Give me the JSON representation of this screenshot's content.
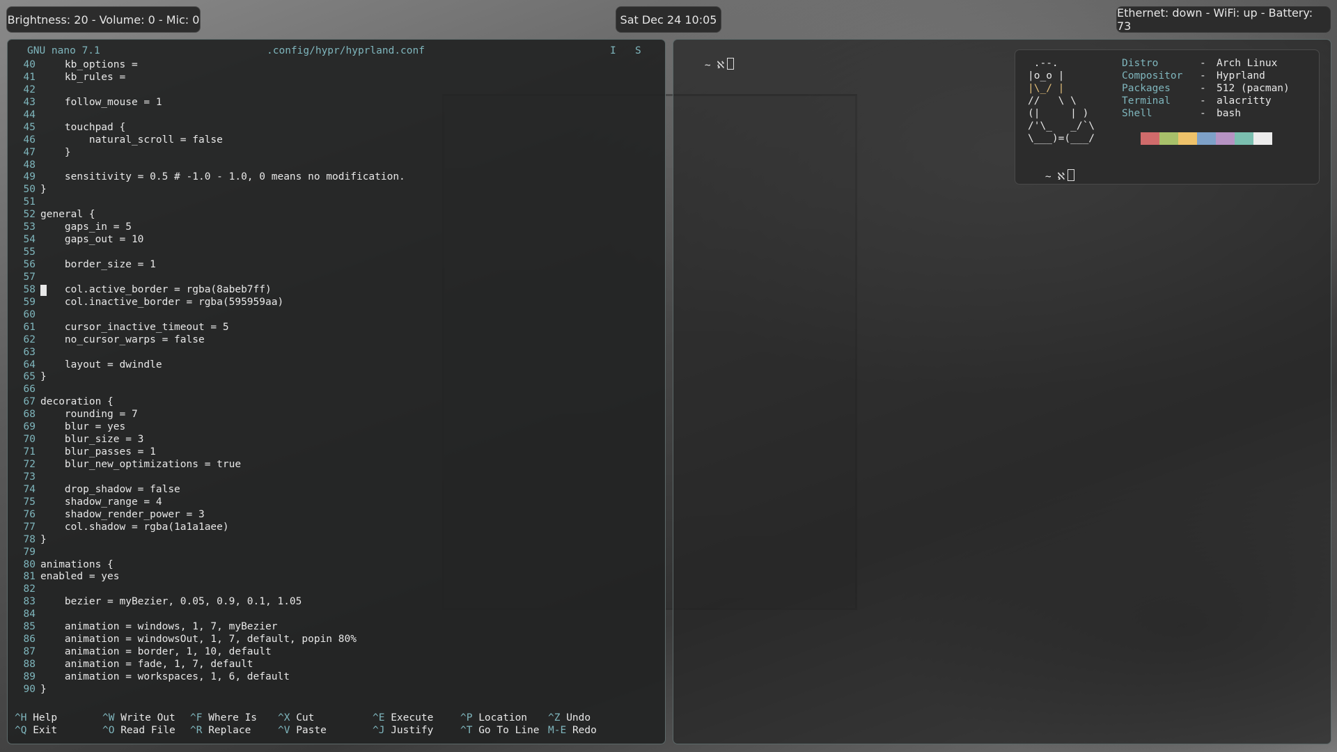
{
  "topbar": {
    "left": "Brightness: 20 - Volume: 0 - Mic: 0",
    "center": "Sat Dec 24 10:05",
    "right": "Ethernet: down - WiFi: up - Battery: 73"
  },
  "nano": {
    "version": "GNU nano 7.1",
    "filename": ".config/hypr/hyprland.conf",
    "flag_i": "I",
    "flag_s": "S",
    "cursor_line": "58",
    "lines": [
      {
        "n": "40",
        "t": "    kb_options ="
      },
      {
        "n": "41",
        "t": "    kb_rules ="
      },
      {
        "n": "42",
        "t": ""
      },
      {
        "n": "43",
        "t": "    follow_mouse = 1"
      },
      {
        "n": "44",
        "t": ""
      },
      {
        "n": "45",
        "t": "    touchpad {"
      },
      {
        "n": "46",
        "t": "        natural_scroll = false"
      },
      {
        "n": "47",
        "t": "    }"
      },
      {
        "n": "48",
        "t": ""
      },
      {
        "n": "49",
        "t": "    sensitivity = 0.5 # -1.0 - 1.0, 0 means no modification."
      },
      {
        "n": "50",
        "t": "}"
      },
      {
        "n": "51",
        "t": ""
      },
      {
        "n": "52",
        "t": "general {"
      },
      {
        "n": "53",
        "t": "    gaps_in = 5"
      },
      {
        "n": "54",
        "t": "    gaps_out = 10"
      },
      {
        "n": "55",
        "t": ""
      },
      {
        "n": "56",
        "t": "    border_size = 1"
      },
      {
        "n": "57",
        "t": ""
      },
      {
        "n": "58",
        "t": "    col.active_border = rgba(8abeb7ff)"
      },
      {
        "n": "59",
        "t": "    col.inactive_border = rgba(595959aa)"
      },
      {
        "n": "60",
        "t": ""
      },
      {
        "n": "61",
        "t": "    cursor_inactive_timeout = 5"
      },
      {
        "n": "62",
        "t": "    no_cursor_warps = false"
      },
      {
        "n": "63",
        "t": ""
      },
      {
        "n": "64",
        "t": "    layout = dwindle"
      },
      {
        "n": "65",
        "t": "}"
      },
      {
        "n": "66",
        "t": ""
      },
      {
        "n": "67",
        "t": "decoration {"
      },
      {
        "n": "68",
        "t": "    rounding = 7"
      },
      {
        "n": "69",
        "t": "    blur = yes"
      },
      {
        "n": "70",
        "t": "    blur_size = 3"
      },
      {
        "n": "71",
        "t": "    blur_passes = 1"
      },
      {
        "n": "72",
        "t": "    blur_new_optimizations = true"
      },
      {
        "n": "73",
        "t": ""
      },
      {
        "n": "74",
        "t": "    drop_shadow = false"
      },
      {
        "n": "75",
        "t": "    shadow_range = 4"
      },
      {
        "n": "76",
        "t": "    shadow_render_power = 3"
      },
      {
        "n": "77",
        "t": "    col.shadow = rgba(1a1a1aee)"
      },
      {
        "n": "78",
        "t": "}"
      },
      {
        "n": "79",
        "t": ""
      },
      {
        "n": "80",
        "t": "animations {"
      },
      {
        "n": "81",
        "t": "enabled = yes"
      },
      {
        "n": "82",
        "t": ""
      },
      {
        "n": "83",
        "t": "    bezier = myBezier, 0.05, 0.9, 0.1, 1.05"
      },
      {
        "n": "84",
        "t": ""
      },
      {
        "n": "85",
        "t": "    animation = windows, 1, 7, myBezier"
      },
      {
        "n": "86",
        "t": "    animation = windowsOut, 1, 7, default, popin 80%"
      },
      {
        "n": "87",
        "t": "    animation = border, 1, 10, default"
      },
      {
        "n": "88",
        "t": "    animation = fade, 1, 7, default"
      },
      {
        "n": "89",
        "t": "    animation = workspaces, 1, 6, default"
      },
      {
        "n": "90",
        "t": "}"
      }
    ],
    "shortcuts_row1": [
      {
        "key": "^H",
        "label": "Help"
      },
      {
        "key": "^W",
        "label": "Write Out"
      },
      {
        "key": "^F",
        "label": "Where Is"
      },
      {
        "key": "^X",
        "label": "Cut"
      },
      {
        "key": "^E",
        "label": "Execute"
      },
      {
        "key": "^P",
        "label": "Location"
      },
      {
        "key": "^Z",
        "label": "Undo"
      }
    ],
    "shortcuts_row2": [
      {
        "key": "^Q",
        "label": "Exit"
      },
      {
        "key": "^O",
        "label": "Read File"
      },
      {
        "key": "^R",
        "label": "Replace"
      },
      {
        "key": "^V",
        "label": "Paste"
      },
      {
        "key": "^J",
        "label": "Justify"
      },
      {
        "key": "^T",
        "label": "Go To Line"
      },
      {
        "key": "M-E",
        "label": "Redo"
      }
    ]
  },
  "terminal": {
    "prompt": "~ ℵ",
    "fetch": {
      "ascii": [
        " .--.",
        "|o_o |",
        "|\\_/ |",
        "//   \\ \\",
        "(|     | )",
        "/'\\_   _/`\\",
        "\\___)=(___/"
      ],
      "rows": [
        {
          "key": "Distro",
          "value": "Arch Linux"
        },
        {
          "key": "Compositor",
          "value": "Hyprland"
        },
        {
          "key": "Packages",
          "value": "512 (pacman)"
        },
        {
          "key": "Terminal",
          "value": "alacritty"
        },
        {
          "key": "Shell",
          "value": "bash"
        }
      ],
      "separator": "-",
      "swatch_colors": [
        "#d06b6b",
        "#a8c06a",
        "#eec26a",
        "#7ea1c8",
        "#b693c3",
        "#7bbfb0",
        "#ececec"
      ]
    },
    "fetch_prompt": "~ ℵ"
  },
  "colors": {
    "accent": "#7fb6bd",
    "text": "#e8e8e8",
    "window_bg": "#222424",
    "border_active": "#8abeb7"
  }
}
